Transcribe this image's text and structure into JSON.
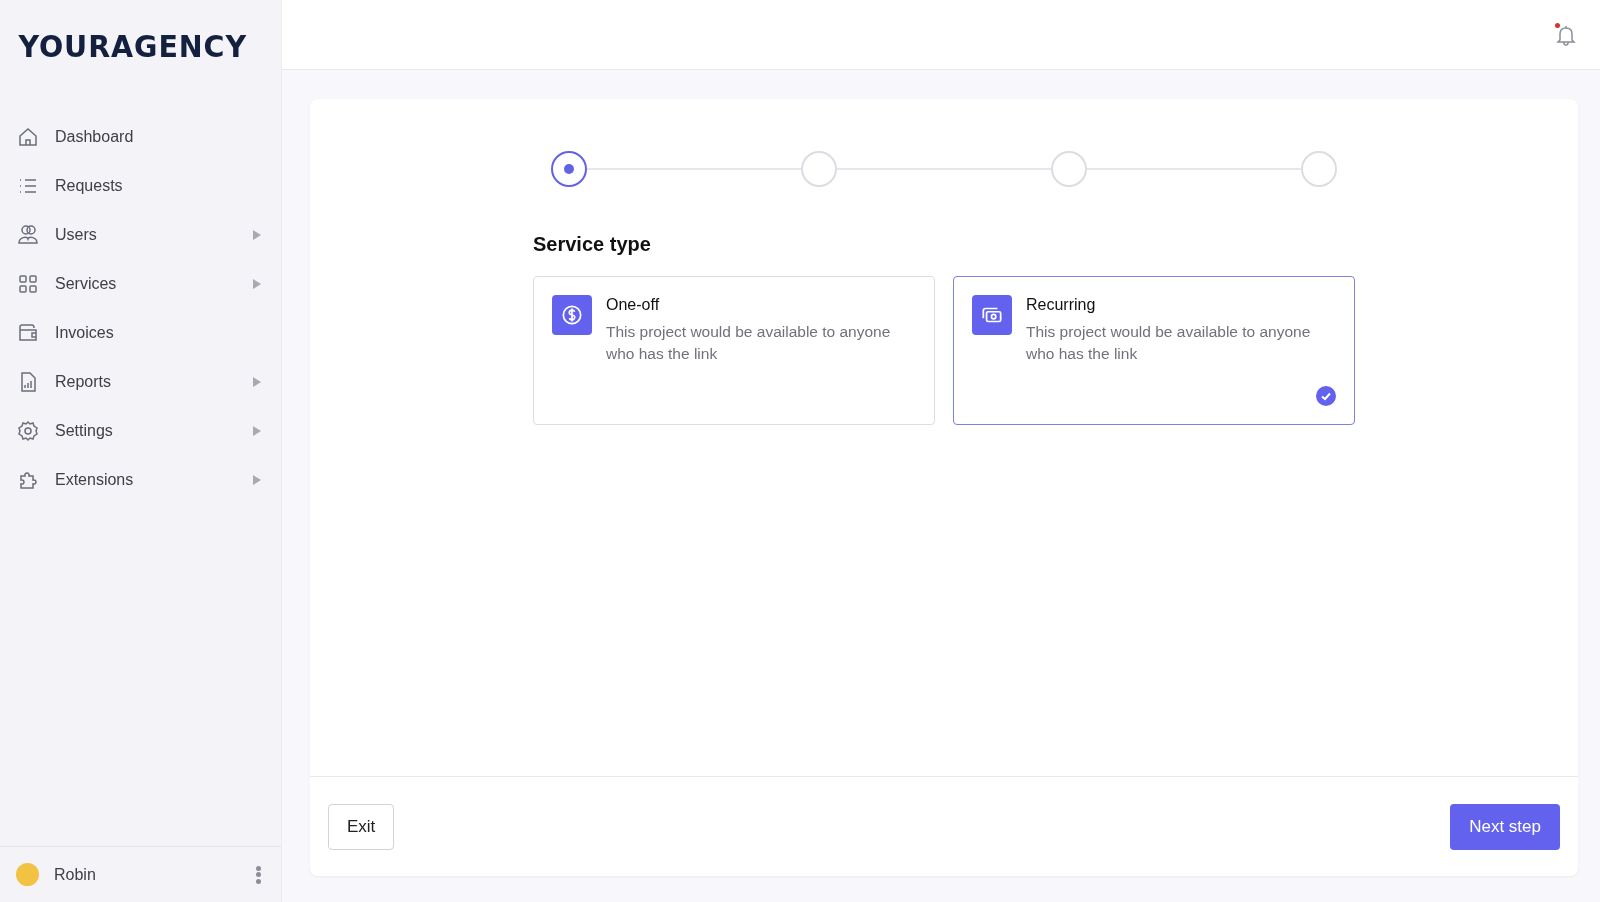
{
  "sidebar": {
    "logo": "YOURAGENCY",
    "items": [
      {
        "label": "Dashboard",
        "kind": "home",
        "expandable": false
      },
      {
        "label": "Requests",
        "kind": "list",
        "expandable": false
      },
      {
        "label": "Users",
        "kind": "users",
        "expandable": true
      },
      {
        "label": "Services",
        "kind": "grid",
        "expandable": true
      },
      {
        "label": "Invoices",
        "kind": "wallet",
        "expandable": false
      },
      {
        "label": "Reports",
        "kind": "report",
        "expandable": true
      },
      {
        "label": "Settings",
        "kind": "gear",
        "expandable": true
      },
      {
        "label": "Extensions",
        "kind": "puzzle",
        "expandable": true
      }
    ],
    "user": {
      "name": "Robin"
    }
  },
  "header": {
    "notifications": {
      "unread": true
    }
  },
  "wizard": {
    "steps": [
      {
        "selected": true
      },
      {
        "selected": false
      },
      {
        "selected": false
      },
      {
        "selected": false
      }
    ],
    "title": "Service type",
    "options": [
      {
        "kind": "dollar",
        "title": "One-off",
        "description": "This project would be available to anyone who has the link",
        "selected": false
      },
      {
        "kind": "cash",
        "title": "Recurring",
        "description": "This project would be available to anyone who has the link",
        "selected": true
      }
    ],
    "buttons": {
      "exit": "Exit",
      "next": "Next step"
    }
  }
}
